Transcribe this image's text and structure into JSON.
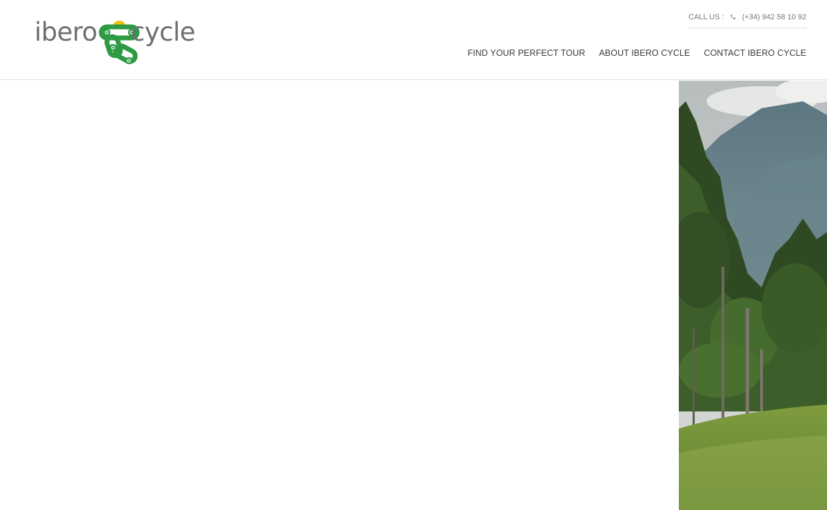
{
  "brand": {
    "logo_left": "ibero",
    "logo_right": "cycle",
    "brand_green": "#2e9a44",
    "sun_yellow": "#f2c200",
    "gray_text": "#6f6f6f"
  },
  "topbar": {
    "call_label": "CALL US :",
    "phone_icon": "phone-icon",
    "phone_number": "(+34) 942 58 10 92"
  },
  "nav": {
    "items": [
      {
        "label": "FIND YOUR PERFECT TOUR"
      },
      {
        "label": "ABOUT IBERO CYCLE"
      },
      {
        "label": "CONTACT IBERO CYCLE"
      }
    ]
  },
  "hero": {
    "image": "forest-mountain-meadow-photo"
  }
}
